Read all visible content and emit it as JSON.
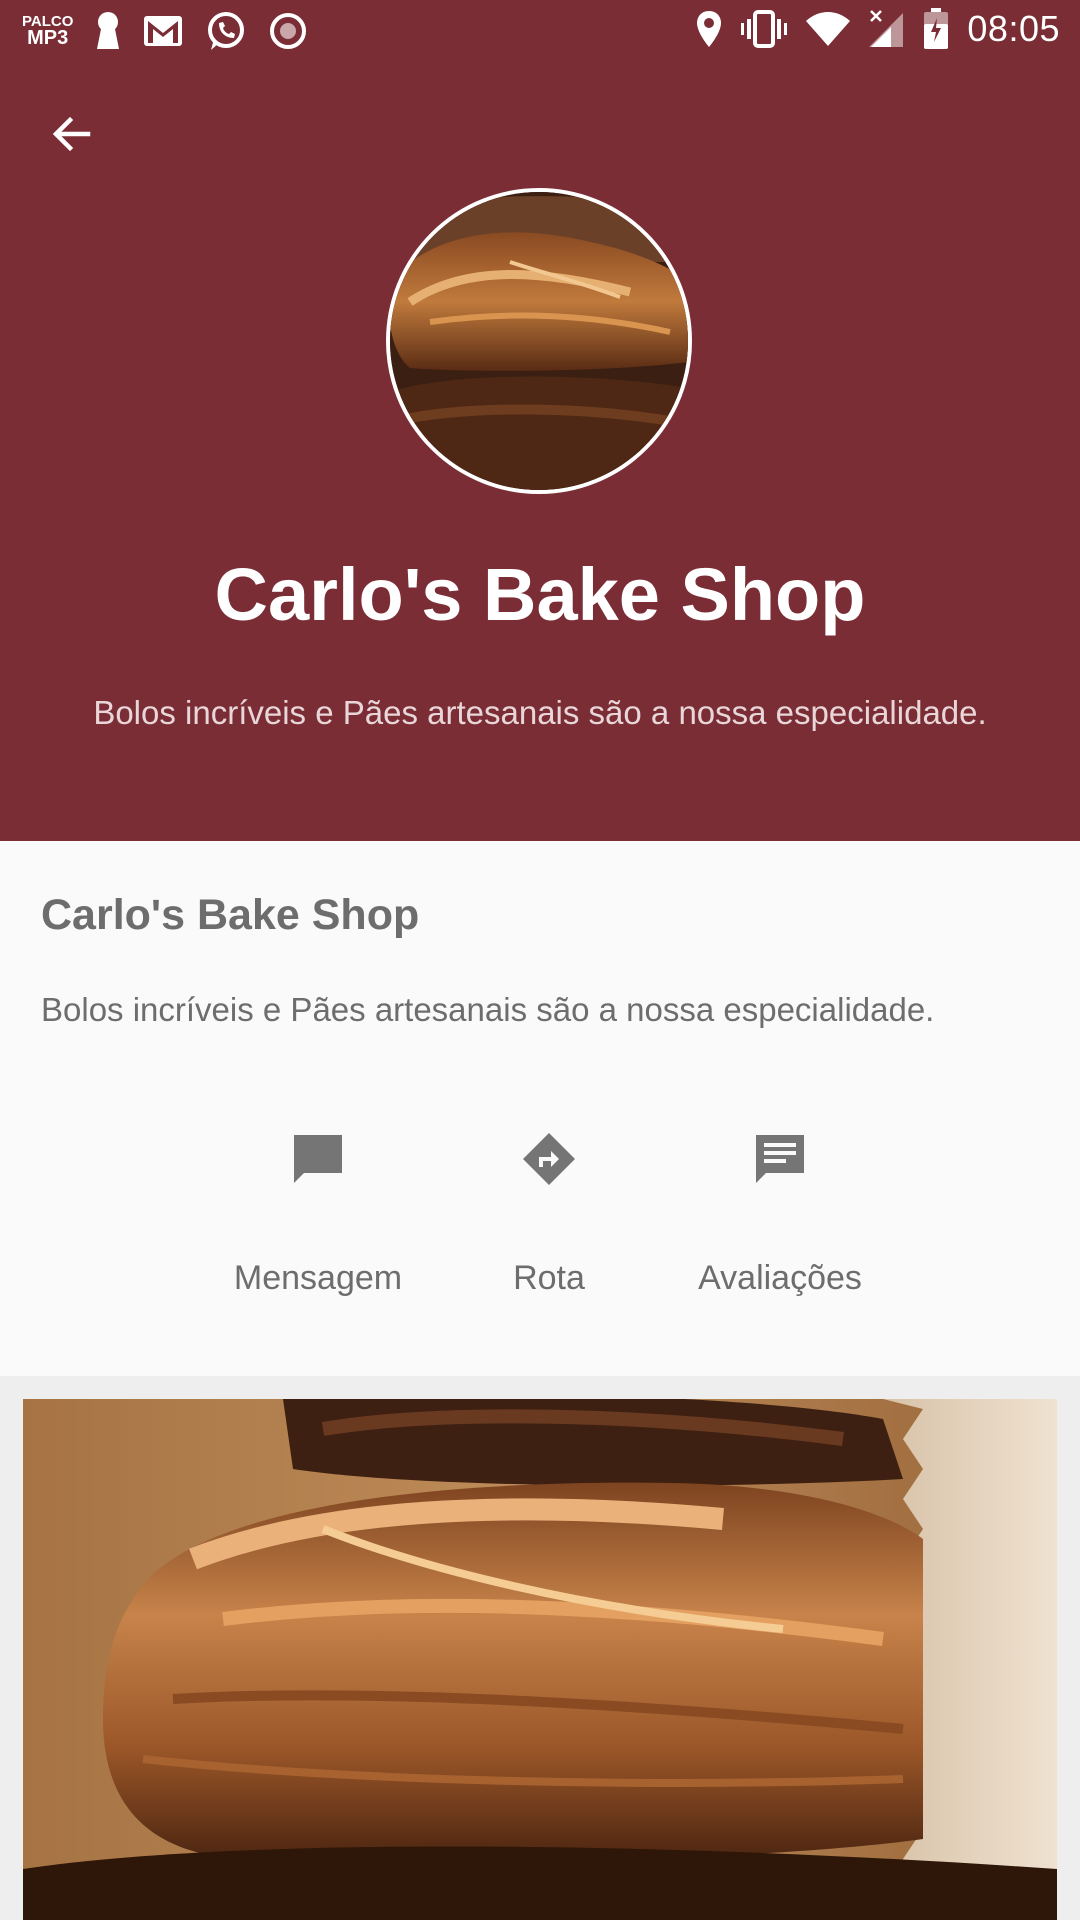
{
  "status_bar": {
    "time": "08:05",
    "left_icons": [
      "palco-mp3-icon",
      "keyhole-icon",
      "gmail-icon",
      "whatsapp-icon",
      "record-icon"
    ],
    "right_icons": [
      "location-icon",
      "vibrate-icon",
      "wifi-icon",
      "signal-icon",
      "battery-icon"
    ],
    "palco_text_top": "PALCO",
    "palco_text_bottom": "MP3"
  },
  "header": {
    "back_icon": "arrow-back-icon",
    "title": "Carlo's Bake Shop",
    "subtitle": "Bolos incríveis e Pães artesanais são a nossa especialidade.",
    "background_color": "#7a2d35"
  },
  "info": {
    "title": "Carlo's Bake Shop",
    "description": "Bolos incríveis e Pães artesanais são a nossa especialidade."
  },
  "actions": [
    {
      "label": "Mensagem",
      "icon": "message-icon"
    },
    {
      "label": "Rota",
      "icon": "directions-icon"
    },
    {
      "label": "Avaliações",
      "icon": "reviews-icon"
    }
  ],
  "colors": {
    "brand": "#7a2d35",
    "text_gray": "#6d6d6d",
    "icon_gray": "#757575",
    "card_bg": "#fafafa"
  }
}
